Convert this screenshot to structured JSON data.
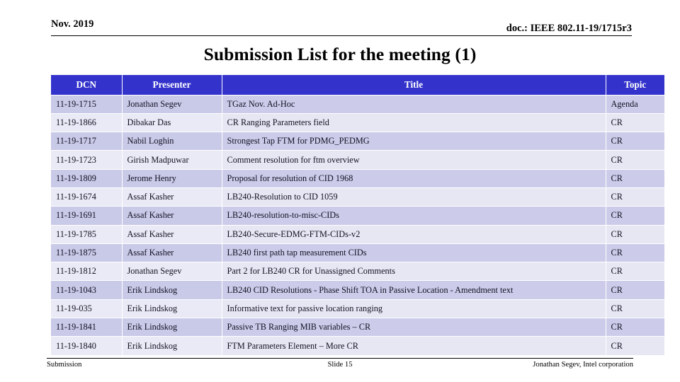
{
  "header": {
    "date": "Nov. 2019",
    "doc_id": "doc.: IEEE 802.11-19/1715r3"
  },
  "title": "Submission List for the meeting (1)",
  "table": {
    "columns": [
      "DCN",
      "Presenter",
      "Title",
      "Topic"
    ],
    "rows": [
      {
        "dcn": "11-19-1715",
        "presenter": "Jonathan Segev",
        "title": "TGaz Nov. Ad-Hoc",
        "topic": "Agenda"
      },
      {
        "dcn": "11-19-1866",
        "presenter": "Dibakar Das",
        "title": "CR Ranging Parameters field",
        "topic": "CR"
      },
      {
        "dcn": "11-19-1717",
        "presenter": "Nabil Loghin",
        "title": "Strongest Tap FTM for PDMG_PEDMG",
        "topic": "CR"
      },
      {
        "dcn": "11-19-1723",
        "presenter": "Girish Madpuwar",
        "title": "Comment resolution for ftm overview",
        "topic": "CR"
      },
      {
        "dcn": "11-19-1809",
        "presenter": "Jerome Henry",
        "title": "Proposal for resolution of CID 1968",
        "topic": "CR"
      },
      {
        "dcn": "11-19-1674",
        "presenter": "Assaf Kasher",
        "title": "LB240-Resolution to CID 1059",
        "topic": "CR"
      },
      {
        "dcn": "11-19-1691",
        "presenter": "Assaf Kasher",
        "title": "LB240-resolution-to-misc-CIDs",
        "topic": "CR"
      },
      {
        "dcn": "11-19-1785",
        "presenter": "Assaf Kasher",
        "title": "LB240-Secure-EDMG-FTM-CIDs-v2",
        "topic": "CR"
      },
      {
        "dcn": "11-19-1875",
        "presenter": "Assaf Kasher",
        "title": "LB240 first path tap measurement CIDs",
        "topic": "CR"
      },
      {
        "dcn": "11-19-1812",
        "presenter": "Jonathan Segev",
        "title": "Part 2 for LB240 CR for Unassigned Comments",
        "topic": "CR"
      },
      {
        "dcn": "11-19-1043",
        "presenter": "Erik Lindskog",
        "title": "LB240 CID Resolutions - Phase Shift TOA in Passive Location - Amendment text",
        "topic": "CR"
      },
      {
        "dcn": "11-19-035",
        "presenter": "Erik Lindskog",
        "title": "Informative text for passive location ranging",
        "topic": "CR"
      },
      {
        "dcn": "11-19-1841",
        "presenter": "Erik Lindskog",
        "title": "Passive TB Ranging MIB variables – CR",
        "topic": "CR"
      },
      {
        "dcn": "11-19-1840",
        "presenter": "Erik Lindskog",
        "title": "FTM Parameters Element – More CR",
        "topic": "CR"
      }
    ]
  },
  "footer": {
    "left": "Submission",
    "center": "Slide 15",
    "right": "Jonathan Segev, Intel corporation"
  },
  "colors": {
    "header_blue": "#3333cc",
    "row_odd": "#ccccea",
    "row_even": "#e7e7f4",
    "text": "#111122"
  }
}
